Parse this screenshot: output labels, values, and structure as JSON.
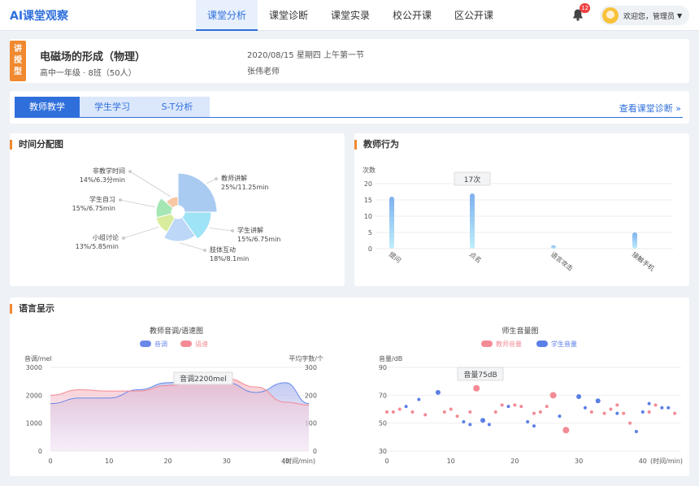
{
  "app": {
    "logo": "AI课堂观察"
  },
  "nav": [
    {
      "label": "课堂分析",
      "active": true
    },
    {
      "label": "课堂诊断",
      "active": false
    },
    {
      "label": "课堂实录",
      "active": false
    },
    {
      "label": "校公开课",
      "active": false
    },
    {
      "label": "区公开课",
      "active": false
    }
  ],
  "header": {
    "notifications": "12",
    "user": "欢迎您，管理员",
    "caret": "▼"
  },
  "lesson": {
    "tag": "讲授型",
    "title": "电磁场的形成（物理）",
    "sub": "高中一年级 · 8班（50人）",
    "date": "2020/08/15  星期四  上午第一节",
    "teacher": "张伟老师"
  },
  "tabs": [
    {
      "label": "教师教学",
      "active": true
    },
    {
      "label": "学生学习",
      "active": false
    },
    {
      "label": "S-T分析",
      "active": false
    }
  ],
  "tab_link": "查看课堂诊断 »",
  "panels": {
    "time": "时间分配图",
    "behavior": "教师行为",
    "language": "语言呈示"
  },
  "chart_data": [
    {
      "type": "pie",
      "title": "",
      "slices": [
        {
          "name": "教师讲解",
          "value": 11.25,
          "label": "25%/11.25min",
          "color": "#a9cbf2"
        },
        {
          "name": "学生讲解",
          "value": 6.75,
          "label": "15%/6.75min",
          "color": "#9fe3f7"
        },
        {
          "name": "肢体互动",
          "value": 8.1,
          "label": "18%/8.1min",
          "color": "#bcd7f7"
        },
        {
          "name": "小组讨论",
          "value": 5.85,
          "label": "13%/5.85min",
          "color": "#d7ec9c"
        },
        {
          "name": "学生自习",
          "value": 6.75,
          "label": "15%/6.75min",
          "color": "#a5e7b4"
        },
        {
          "name": "非教学时间",
          "value": 6.3,
          "label": "14%/6.3分min",
          "color": "#f8c7a4"
        }
      ]
    },
    {
      "type": "bar",
      "title": "",
      "ylabel": "次数",
      "ylim": [
        0,
        20
      ],
      "yticks": [
        0,
        5,
        10,
        15,
        20
      ],
      "categories": [
        "提问",
        "点名",
        "语言攻击",
        "接触手机"
      ],
      "values": [
        16,
        17,
        1,
        5
      ],
      "tooltip": "17次"
    },
    {
      "type": "area",
      "title": "教师音调/语速图",
      "legend": [
        "音调",
        "语速"
      ],
      "ylabel_left": "音调/mel",
      "ylabel_right": "平均字数/个",
      "xlabel": "(时间/min)",
      "x": [
        0,
        5,
        10,
        15,
        20,
        25,
        30,
        35,
        40,
        44
      ],
      "xticks": [
        0,
        10,
        20,
        30,
        40
      ],
      "ylim_left": [
        0,
        3000
      ],
      "yticks_left": [
        0,
        1000,
        2000,
        3000
      ],
      "ylim_right": [
        0,
        300
      ],
      "yticks_right": [
        0,
        100,
        200,
        300
      ],
      "series": [
        {
          "name": "音调",
          "color": "#6a88e8",
          "values": [
            1700,
            1900,
            1900,
            2200,
            2450,
            2550,
            2450,
            2100,
            2450,
            1700
          ]
        },
        {
          "name": "语速",
          "color": "#f38b96",
          "values": [
            200,
            220,
            215,
            215,
            235,
            250,
            260,
            230,
            175,
            165
          ]
        }
      ],
      "tooltip": "音调2200mel"
    },
    {
      "type": "scatter",
      "title": "师生音量图",
      "legend": [
        "教师音量",
        "学生音量"
      ],
      "ylabel": "音量/dB",
      "xlabel": "(时间/min)",
      "xlim": [
        0,
        46
      ],
      "xticks": [
        0,
        10,
        20,
        30,
        40
      ],
      "ylim": [
        30,
        90
      ],
      "yticks": [
        30,
        50,
        70,
        90
      ],
      "tooltip": "音量75dB",
      "series": [
        {
          "name": "教师音量",
          "color": "#f38b96",
          "x": [
            0,
            1,
            2,
            4,
            6,
            9,
            10,
            11,
            13,
            14,
            17,
            18,
            20,
            21,
            23,
            24,
            25,
            26,
            28,
            32,
            34,
            35,
            36,
            37,
            38,
            41,
            42,
            45
          ],
          "y": [
            58,
            58,
            60,
            58,
            56,
            58,
            60,
            55,
            58,
            75,
            58,
            63,
            63,
            62,
            57,
            58,
            62,
            70,
            45,
            58,
            57,
            60,
            63,
            57,
            50,
            58,
            63,
            57
          ],
          "r": [
            2,
            2,
            2,
            2,
            2,
            2,
            2,
            2,
            2,
            4,
            2,
            2,
            2,
            2,
            2,
            2,
            2,
            4,
            4,
            2,
            2,
            2,
            2,
            2,
            2,
            2,
            2,
            2
          ]
        },
        {
          "name": "学生音量",
          "color": "#5a7fe6",
          "x": [
            3,
            5,
            8,
            12,
            13,
            15,
            16,
            19,
            22,
            23,
            27,
            30,
            31,
            33,
            36,
            39,
            40,
            41,
            43,
            44
          ],
          "y": [
            62,
            67,
            72,
            51,
            49,
            52,
            49,
            62,
            51,
            48,
            55,
            69,
            61,
            66,
            57,
            44,
            58,
            64,
            61,
            61
          ],
          "r": [
            2,
            2,
            3,
            2,
            2,
            3,
            2,
            2,
            2,
            2,
            2,
            3,
            2,
            3,
            2,
            2,
            2,
            2,
            2,
            2
          ]
        }
      ]
    }
  ]
}
